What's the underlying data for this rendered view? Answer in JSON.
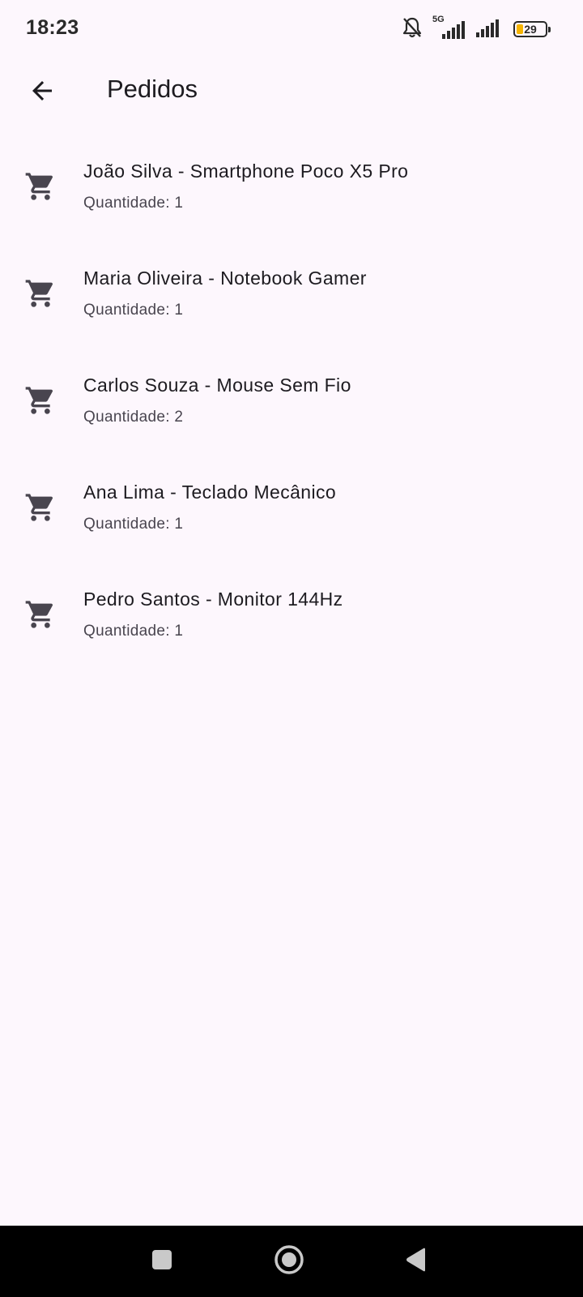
{
  "status_bar": {
    "time": "18:23",
    "network": "5G",
    "battery": "29",
    "icons": [
      "bell-muted-icon",
      "signal-icon",
      "signal-icon",
      "battery-icon"
    ]
  },
  "app_bar": {
    "title": "Pedidos",
    "back_icon": "arrow-back-icon"
  },
  "orders": [
    {
      "title": "João Silva - Smartphone Poco X5 Pro",
      "quantity": "Quantidade: 1",
      "icon": "shopping-cart-icon"
    },
    {
      "title": "Maria Oliveira - Notebook Gamer",
      "quantity": "Quantidade: 1",
      "icon": "shopping-cart-icon"
    },
    {
      "title": "Carlos Souza - Mouse Sem Fio",
      "quantity": "Quantidade: 2",
      "icon": "shopping-cart-icon"
    },
    {
      "title": "Ana Lima - Teclado Mecânico",
      "quantity": "Quantidade: 1",
      "icon": "shopping-cart-icon"
    },
    {
      "title": "Pedro Santos - Monitor 144Hz",
      "quantity": "Quantidade: 1",
      "icon": "shopping-cart-icon"
    }
  ],
  "nav_bar": {
    "buttons": [
      "recents-icon",
      "home-icon",
      "back-triangle-icon"
    ]
  },
  "colors": {
    "background": "#fdf7fd",
    "text_primary": "#1d1b20",
    "text_secondary": "#49454f",
    "icon": "#49454f",
    "battery_fill": "#f5b400",
    "nav_bar": "#000000"
  }
}
